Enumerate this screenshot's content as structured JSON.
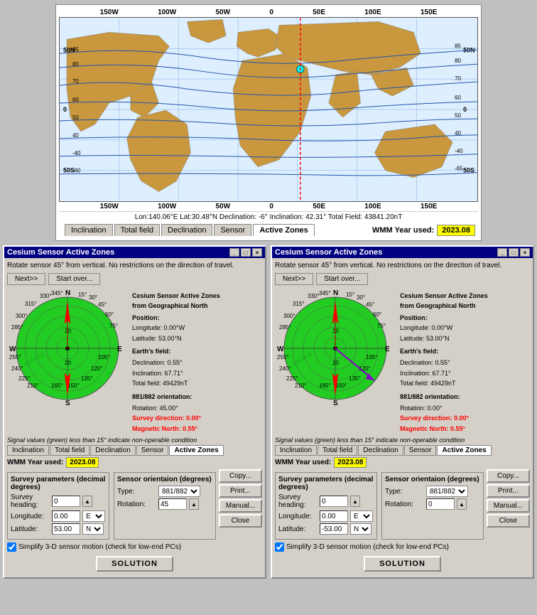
{
  "topMap": {
    "axisLabels": {
      "top": [
        "150W",
        "100W",
        "50W",
        "0",
        "50E",
        "100E",
        "150E"
      ],
      "bottom": [
        "150W",
        "100W",
        "50W",
        "0",
        "50E",
        "100E",
        "150E"
      ],
      "leftTop": "50N",
      "leftMid": "0",
      "leftBot": "50S",
      "rightTop": "50N",
      "rightMid": "0",
      "rightBot": "50S"
    },
    "coordBar": "Lon:140.06°E  Lat:30.48°N   Declination: -6°   Inclination: 42.31°   Total Field: 43841.20nT",
    "tabs": [
      "Inclination",
      "Total field",
      "Declination",
      "Sensor",
      "Active Zones"
    ],
    "activeTab": "Active Zones",
    "wmmLabel": "WMM Year used:",
    "wmmValue": "2023.08"
  },
  "leftWindow": {
    "title": "Cesium Sensor Active Zones",
    "headerText": "Rotate sensor 45° from vertical. No restrictions on the\ndirection of travel.",
    "nextBtn": "Next>>",
    "startOverBtn": "Start over...",
    "compassInfo": {
      "title": "Cesium Sensor Active Zones\nfrom Geographical North",
      "positionLabel": "Position:",
      "longitude": "Longitude: 0.00°W",
      "latitude": "Latitude:  53.00°N",
      "earthFieldLabel": "Earth's field:",
      "declination": "Declination: 0.55°",
      "inclination": "Inclination: 67.71°",
      "totalField": "Total field: 49429nT",
      "orientLabel": "881/882 orientation:",
      "rotation": "Rotation: 45.00°",
      "surveyDir": "Survey direction: 0.00°",
      "magNorth": "Magnetic North: 0.55°"
    },
    "signalNote": "Signal values (green) less than 15° indicate non-operable condition",
    "tabs": [
      "Inclination",
      "Total field",
      "Declination",
      "Sensor",
      "Active Zones"
    ],
    "activeTab": "Active Zones",
    "wmmLabel": "WMM Year used:",
    "wmmValue": "2023.08",
    "params": {
      "surveyTitle": "Survey parameters (decimal degrees)",
      "surveyHeadingLabel": "Survey heading:",
      "surveyHeadingValue": "0",
      "longitudeLabel": "Longitude:",
      "longitudeValue": "0.00",
      "longitudeDir": "E",
      "latitudeLabel": "Latitude:",
      "latitudeValue": "53.00",
      "latitudeDir": "N",
      "sensorTitle": "Sensor orientaion (degrees)",
      "typeLabel": "Type:",
      "typeValue": "881/882",
      "rotationLabel": "Rotation:",
      "rotationValue": "45"
    },
    "copyBtn": "Copy...",
    "printBtn": "Print...",
    "manualBtn": "Manual...",
    "closeBtn": "Close",
    "simplifyLabel": "Simplify 3-D sensor motion (check for low-end PCs)",
    "simplifyChecked": true,
    "solutionBtn": "SOLUTION"
  },
  "rightWindow": {
    "title": "Cesium Sensor Active Zones",
    "headerText": "Rotate sensor 45° from vertical. No restrictions on the\ndirection of travel.",
    "nextBtn": "Next>>",
    "startOverBtn": "Start over...",
    "compassInfo": {
      "title": "Cesium Sensor Active Zones\nfrom Geographical North",
      "positionLabel": "Position:",
      "longitude": "Longitude: 0.00°W",
      "latitude": "Latitude:  53.00°N",
      "earthFieldLabel": "Earth's field:",
      "declination": "Declination: 0.55°",
      "inclination": "Inclination: 67.71°",
      "totalField": "Total field: 49429nT",
      "orientLabel": "881/882 orientation:",
      "rotation": "Rotation: 0.00°",
      "surveyDir": "Survey direction: 0.00°",
      "magNorth": "Magnetic North: 0.55°"
    },
    "signalNote": "Signal values (green) less than 15° indicate non-operable condition",
    "tabs": [
      "Inclination",
      "Total field",
      "Declination",
      "Sensor",
      "Active Zones"
    ],
    "activeTab": "Active Zones",
    "wmmLabel": "WMM Year used:",
    "wmmValue": "2023.08",
    "params": {
      "surveyTitle": "Survey parameters (decimal degrees)",
      "surveyHeadingLabel": "Survey heading:",
      "surveyHeadingValue": "0",
      "longitudeLabel": "Longitude:",
      "longitudeValue": "0.00",
      "longitudeDir": "E",
      "latitudeLabel": "Latitude:",
      "latitudeValue": "-53.00",
      "latitudeDir": "N",
      "sensorTitle": "Sensor orientaion (degrees)",
      "typeLabel": "Type:",
      "typeValue": "881/882",
      "rotationLabel": "Rotation:",
      "rotationValue": "0"
    },
    "copyBtn": "Copy...",
    "printBtn": "Print...",
    "manualBtn": "Manual...",
    "closeBtn": "Close",
    "simplifyLabel": "Simplify 3-D sensor motion (check for low-end PCs)",
    "simplifyChecked": true,
    "solutionBtn": "SOLUTION"
  }
}
